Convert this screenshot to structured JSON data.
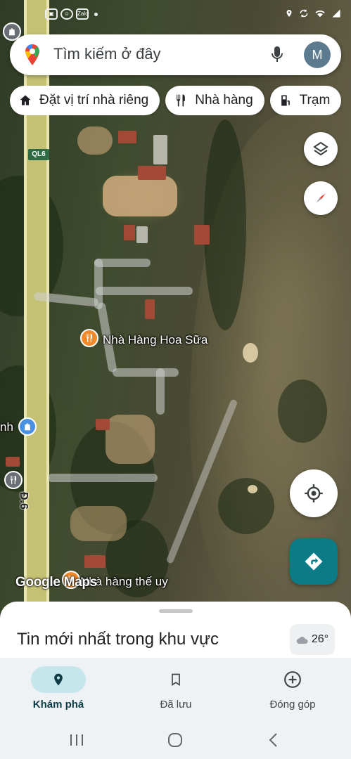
{
  "status_bar": {
    "left_icons": [
      "gallery-icon",
      "smiley-icon",
      "zalo-icon"
    ],
    "zalo_text": "Zalo",
    "right_icons": [
      "location-icon",
      "sync-icon",
      "wifi-icon",
      "signal-icon"
    ]
  },
  "search": {
    "placeholder": "Tìm kiếm ở đây",
    "avatar_letter": "M"
  },
  "chips": [
    {
      "label": "Đặt vị trí nhà riêng",
      "icon": "home-icon"
    },
    {
      "label": "Nhà hàng",
      "icon": "restaurant-icon"
    },
    {
      "label": "Trạm",
      "icon": "gas-station-icon"
    }
  ],
  "map": {
    "road_label": "QL6",
    "road_name": "Đ.6",
    "places": [
      {
        "name": "Nhà Hàng Hoa Sữa",
        "icon": "restaurant-icon",
        "color": "#f08a2b"
      },
      {
        "name": "Nhà hàng thế uy",
        "icon": "restaurant-icon",
        "color": "#f08a2b"
      },
      {
        "name": "nh",
        "icon": "shopping-icon",
        "color": "#4a8fe0"
      },
      {
        "name": "",
        "icon": "restaurant-icon",
        "color": "#6a6f75"
      }
    ],
    "google_logo": "Google Maps"
  },
  "sheet": {
    "title": "Tin mới nhất trong khu vực",
    "weather": "26°"
  },
  "nav": {
    "items": [
      {
        "label": "Khám phá",
        "icon": "explore-pin-icon",
        "active": true
      },
      {
        "label": "Đã lưu",
        "icon": "bookmark-icon",
        "active": false
      },
      {
        "label": "Đóng góp",
        "icon": "add-circle-icon",
        "active": false
      }
    ]
  },
  "colors": {
    "accent": "#0b7b86",
    "nav_active": "#c5e7ec",
    "poi_orange": "#f08a2b",
    "poi_blue": "#4a8fe0"
  }
}
